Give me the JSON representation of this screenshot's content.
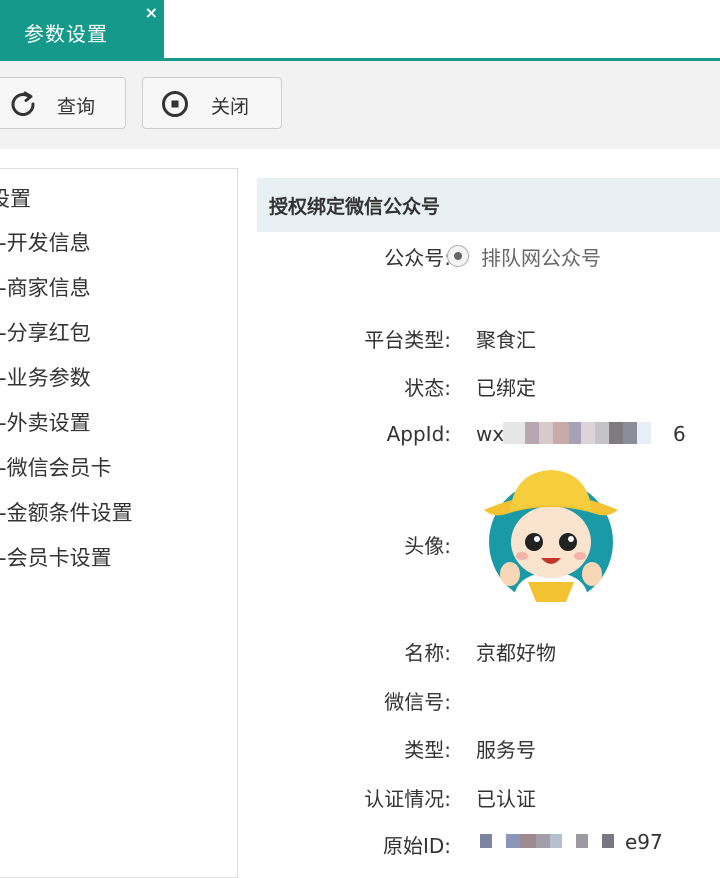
{
  "tabs": {
    "active_label": "参数设置",
    "close_glyph": "×",
    "accent_color": "#14998a"
  },
  "toolbar": {
    "query_label": "查询",
    "close_label": "关闭",
    "query_icon": "refresh-icon",
    "close_icon": "stop-circle-icon"
  },
  "tree": {
    "root_label": "设置",
    "items": [
      {
        "label": "-开发信息"
      },
      {
        "label": "-商家信息"
      },
      {
        "label": "-分享红包"
      },
      {
        "label": "-业务参数"
      },
      {
        "label": "-外卖设置"
      },
      {
        "label": "-微信会员卡"
      },
      {
        "label": "-金额条件设置"
      },
      {
        "label": "-会员卡设置"
      }
    ]
  },
  "panel": {
    "title": "授权绑定微信公众号",
    "account_label": "公众号:",
    "account_option": "排队网公众号",
    "platform_label": "平台类型:",
    "platform_value": "聚食汇",
    "status_label": "状态:",
    "status_value": "已绑定",
    "appid_label": "AppId:",
    "appid_prefix": "wx",
    "appid_suffix": "6",
    "avatar_label": "头像:",
    "name_label": "名称:",
    "name_value": "京都好物",
    "wechat_id_label": "微信号:",
    "wechat_id_value": "",
    "type_label": "类型:",
    "type_value": "服务号",
    "verify_label": "认证情况:",
    "verify_value": "已认证",
    "original_id_label": "原始ID:",
    "original_id_suffix": "e97"
  }
}
